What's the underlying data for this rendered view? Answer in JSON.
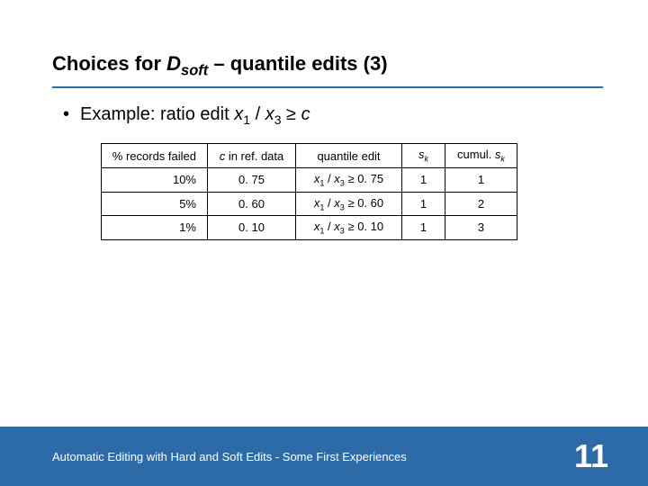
{
  "title": {
    "pre": "Choices for ",
    "D": "D",
    "sub": "soft",
    "post": " – quantile edits (3)"
  },
  "bullet": {
    "pre": "Example: ratio edit ",
    "x1": "x",
    "s1": "1",
    "sep": " / ",
    "x3": "x",
    "s3": "3",
    "rel": " ≥ ",
    "c": "c"
  },
  "table": {
    "headers": {
      "h0": "% records failed",
      "h1_c": "c",
      "h1_rest": " in ref. data",
      "h2": "quantile edit",
      "h3_s": "s",
      "h3_k": "k",
      "h4_pre": "cumul. ",
      "h4_s": "s",
      "h4_k": "k"
    },
    "rows": [
      {
        "pct": "10%",
        "c": "0. 75",
        "q_val": "0. 75",
        "sk": "1",
        "cum": "1"
      },
      {
        "pct": "5%",
        "c": "0. 60",
        "q_val": "0. 60",
        "sk": "1",
        "cum": "2"
      },
      {
        "pct": "1%",
        "c": "0. 10",
        "q_val": "0. 10",
        "sk": "1",
        "cum": "3"
      }
    ],
    "qtemplate": {
      "x1": "x",
      "s1": "1",
      "sep": " / ",
      "x3": "x",
      "s3": "3",
      "rel": " ≥ "
    }
  },
  "footer": {
    "text": "Automatic Editing with Hard and Soft Edits - Some First Experiences",
    "page": "11"
  }
}
